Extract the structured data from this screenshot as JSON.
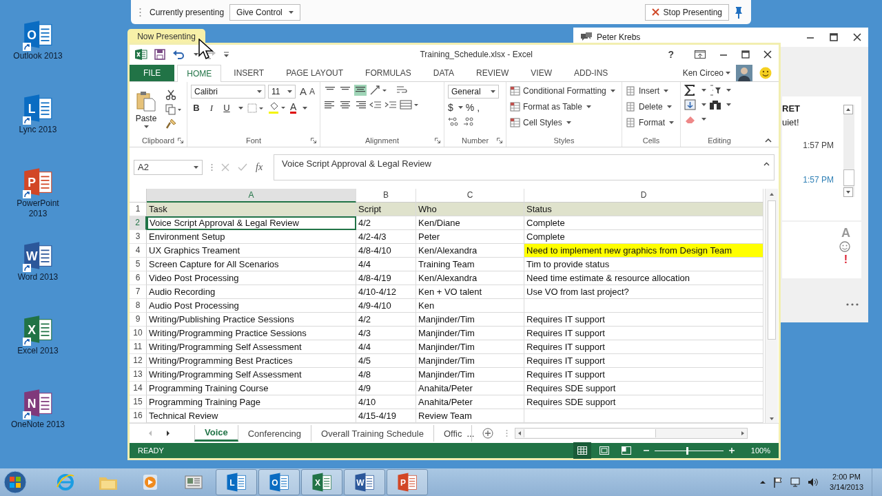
{
  "desktop_icons": [
    {
      "label": "Outlook 2013",
      "letter": "O",
      "color": "#0a6cc2"
    },
    {
      "label": "Lync 2013",
      "letter": "L",
      "color": "#0a6cc2"
    },
    {
      "label": "PowerPoint 2013",
      "letter": "P",
      "color": "#d24726"
    },
    {
      "label": "Word 2013",
      "letter": "W",
      "color": "#2b579a"
    },
    {
      "label": "Excel 2013",
      "letter": "X",
      "color": "#217346"
    },
    {
      "label": "OneNote 2013",
      "letter": "N",
      "color": "#80397b"
    }
  ],
  "presenting_bar": {
    "status": "Currently presenting",
    "give_control": "Give Control",
    "stop": "Stop Presenting"
  },
  "now_presenting_tab": "Now Presenting",
  "lync_window": {
    "title": "Peter Krebs",
    "message_fragments": [
      "RET",
      "uiet!"
    ],
    "times": [
      {
        "text": "1:57 PM",
        "highlighted": false
      },
      {
        "text": "1:57 PM",
        "highlighted": true
      }
    ],
    "font_button": "A",
    "important_button": "!"
  },
  "excel": {
    "title": "Training_Schedule.xlsx - Excel",
    "help": "?",
    "user": "Ken Circeo",
    "ribbon_tabs": [
      {
        "label": "FILE",
        "kind": "file",
        "selected": false
      },
      {
        "label": "HOME",
        "kind": "tab",
        "selected": true
      },
      {
        "label": "INSERT",
        "kind": "tab",
        "selected": false
      },
      {
        "label": "PAGE LAYOUT",
        "kind": "tab",
        "selected": false
      },
      {
        "label": "FORMULAS",
        "kind": "tab",
        "selected": false
      },
      {
        "label": "DATA",
        "kind": "tab",
        "selected": false
      },
      {
        "label": "REVIEW",
        "kind": "tab",
        "selected": false
      },
      {
        "label": "VIEW",
        "kind": "tab",
        "selected": false
      },
      {
        "label": "ADD-INS",
        "kind": "tab",
        "selected": false
      }
    ],
    "ribbon": {
      "clipboard": {
        "label": "Clipboard",
        "paste": "Paste"
      },
      "font": {
        "label": "Font",
        "family": "Calibri",
        "size": "11",
        "grow": "A",
        "shrink": "A",
        "bold": "B",
        "italic": "I",
        "underline": "U",
        "font_color": "A"
      },
      "alignment": {
        "label": "Alignment"
      },
      "number": {
        "label": "Number",
        "format": "General",
        "currency": "$",
        "percent": "%",
        "comma": ","
      },
      "styles": {
        "label": "Styles",
        "items": [
          "Conditional Formatting",
          "Format as Table",
          "Cell Styles"
        ]
      },
      "cells": {
        "label": "Cells",
        "items": [
          "Insert",
          "Delete",
          "Format"
        ]
      },
      "editing": {
        "label": "Editing"
      }
    },
    "name_box": "A2",
    "fx": "fx",
    "formula": "Voice Script Approval & Legal Review",
    "columns": [
      {
        "label": "A",
        "selected": true
      },
      {
        "label": "B",
        "selected": false
      },
      {
        "label": "C",
        "selected": false
      },
      {
        "label": "D",
        "selected": false
      }
    ],
    "rows": [
      {
        "number": "1",
        "kind": "header",
        "selected": false,
        "status_highlighted": false,
        "cells": [
          "Task",
          "Script",
          "Who",
          "Status"
        ]
      },
      {
        "number": "2",
        "kind": "data",
        "selected": true,
        "status_highlighted": false,
        "cells": [
          "Voice Script Approval & Legal Review",
          "4/2",
          "Ken/Diane",
          "Complete"
        ]
      },
      {
        "number": "3",
        "kind": "data",
        "selected": false,
        "status_highlighted": false,
        "cells": [
          "Environment Setup",
          "4/2-4/3",
          "Peter",
          "Complete"
        ]
      },
      {
        "number": "4",
        "kind": "data",
        "selected": false,
        "status_highlighted": true,
        "cells": [
          "UX Graphics Treament",
          "4/8-4/10",
          "Ken/Alexandra",
          "Need to implement new graphics from Design Team"
        ]
      },
      {
        "number": "5",
        "kind": "data",
        "selected": false,
        "status_highlighted": false,
        "cells": [
          "Screen Capture for All Scenarios",
          "4/4",
          "Training Team",
          "Tim to provide status"
        ]
      },
      {
        "number": "6",
        "kind": "data",
        "selected": false,
        "status_highlighted": false,
        "cells": [
          "Video Post Processing",
          "4/8-4/19",
          "Ken/Alexandra",
          "Need time estimate & resource allocation"
        ]
      },
      {
        "number": "7",
        "kind": "data",
        "selected": false,
        "status_highlighted": false,
        "cells": [
          "Audio Recording",
          "4/10-4/12",
          "Ken + VO talent",
          "Use VO from last project?"
        ]
      },
      {
        "number": "8",
        "kind": "data",
        "selected": false,
        "status_highlighted": false,
        "cells": [
          "Audio Post Processing",
          "4/9-4/10",
          "Ken",
          ""
        ]
      },
      {
        "number": "9",
        "kind": "data",
        "selected": false,
        "status_highlighted": false,
        "cells": [
          "Writing/Publishing Practice Sessions",
          "4/2",
          "Manjinder/Tim",
          "Requires IT support"
        ]
      },
      {
        "number": "10",
        "kind": "data",
        "selected": false,
        "status_highlighted": false,
        "cells": [
          "Writing/Programming Practice Sessions",
          "4/3",
          "Manjinder/Tim",
          "Requires IT support"
        ]
      },
      {
        "number": "11",
        "kind": "data",
        "selected": false,
        "status_highlighted": false,
        "cells": [
          "Writing/Programming Self Assessment",
          "4/4",
          "Manjinder/Tim",
          "Requires IT support"
        ]
      },
      {
        "number": "12",
        "kind": "data",
        "selected": false,
        "status_highlighted": false,
        "cells": [
          "Writing/Programming Best Practices",
          "4/5",
          "Manjinder/Tim",
          "Requires IT support"
        ]
      },
      {
        "number": "13",
        "kind": "data",
        "selected": false,
        "status_highlighted": false,
        "cells": [
          "Writing/Programming Self Assessment",
          "4/8",
          "Manjinder/Tim",
          "Requires IT support"
        ]
      },
      {
        "number": "14",
        "kind": "data",
        "selected": false,
        "status_highlighted": false,
        "cells": [
          "Programming Training Course",
          "4/9",
          "Anahita/Peter",
          "Requires SDE support"
        ]
      },
      {
        "number": "15",
        "kind": "data",
        "selected": false,
        "status_highlighted": false,
        "cells": [
          "Programming Training Page",
          "4/10",
          "Anahita/Peter",
          "Requires SDE support"
        ]
      },
      {
        "number": "16",
        "kind": "data",
        "selected": false,
        "status_highlighted": false,
        "cells": [
          "Technical Review",
          "4/15-4/19",
          "Review Team",
          ""
        ]
      }
    ],
    "sheet_tabs": [
      {
        "label": "Voice",
        "selected": true
      },
      {
        "label": "Conferencing",
        "selected": false
      },
      {
        "label": "Overall Training Schedule",
        "selected": false
      },
      {
        "label": "Offic",
        "selected": false
      }
    ],
    "more_tabs": "...",
    "status": "READY",
    "zoom": {
      "level": 0.47,
      "reading": "100%"
    }
  },
  "taskbar": {
    "items": [
      {
        "kind": "browser",
        "open": false
      },
      {
        "kind": "folder",
        "open": false
      },
      {
        "kind": "media",
        "open": false
      },
      {
        "kind": "reader",
        "open": false
      },
      {
        "kind": "app",
        "letter": "L",
        "color": "#0a6cc2",
        "open": true
      },
      {
        "kind": "app",
        "letter": "O",
        "color": "#0a6cc2",
        "open": true
      },
      {
        "kind": "app",
        "letter": "X",
        "color": "#217346",
        "open": true
      },
      {
        "kind": "app",
        "letter": "W",
        "color": "#2b579a",
        "open": true
      },
      {
        "kind": "app",
        "letter": "P",
        "color": "#d24726",
        "open": true
      }
    ],
    "time": "2:00 PM",
    "date": "3/14/2013"
  }
}
